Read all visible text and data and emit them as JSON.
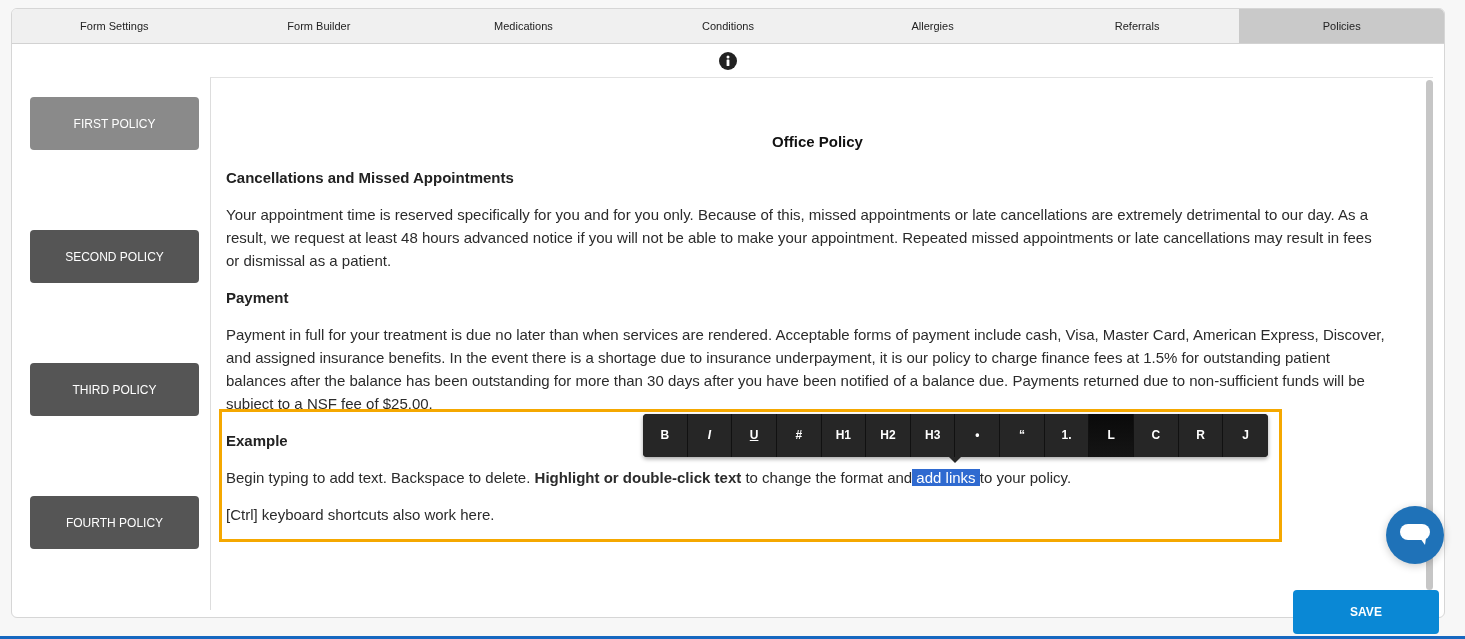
{
  "tabs": [
    {
      "label": "Form Settings",
      "selected": false
    },
    {
      "label": "Form Builder",
      "selected": false
    },
    {
      "label": "Medications",
      "selected": false
    },
    {
      "label": "Conditions",
      "selected": false
    },
    {
      "label": "Allergies",
      "selected": false
    },
    {
      "label": "Referrals",
      "selected": false
    },
    {
      "label": "Policies",
      "selected": true
    }
  ],
  "policies": [
    {
      "label": "FIRST POLICY",
      "selected": true
    },
    {
      "label": "SECOND POLICY",
      "selected": false
    },
    {
      "label": "THIRD POLICY",
      "selected": false
    },
    {
      "label": "FOURTH POLICY",
      "selected": false
    }
  ],
  "editor": {
    "title": "Office Policy",
    "sections": [
      {
        "heading": "Cancellations and Missed Appointments",
        "focused": false,
        "paragraphs": [
          [
            {
              "text": "Your appointment time is reserved specifically for you and for you only. Because of this, missed appointments or late cancellations are extremely detrimental to our day. As a result, we request at least 48 hours advanced notice if you will not be able to make your appointment. Repeated missed appointments or late cancellations may result in fees or dismissal as a patient.",
              "highlighted": false
            }
          ]
        ]
      },
      {
        "heading": "Payment",
        "focused": false,
        "paragraphs": [
          [
            {
              "text": "Payment in full for your treatment is due no later than when services are rendered. Acceptable forms of payment include cash, Visa, Master Card, American Express, Discover, and assigned insurance benefits. In the event there is a shortage due to insurance underpayment, it is our policy to charge finance fees at 1.5% for outstanding patient balances after the balance has been outstanding for more than 30 days after you have been notified of a balance due. Payments returned due to non-sufficient funds will be subject to a NSF fee of $25.00.",
              "highlighted": false
            }
          ]
        ]
      },
      {
        "heading": "Example",
        "focused": true,
        "paragraphs": [
          [
            {
              "text": "Begin typing to add text. Backspace to delete. **Highlight or double-click text** to change the format and",
              "highlighted": false
            },
            {
              "text": " add links ",
              "highlighted": true
            },
            {
              "text": "to your policy.",
              "highlighted": false
            }
          ],
          [
            {
              "text": "[Ctrl] keyboard shortcuts also work here.",
              "highlighted": false
            }
          ]
        ],
        "toolbar": [
          {
            "label": "B",
            "kind": "bold",
            "selected": false
          },
          {
            "label": "I",
            "kind": "italic",
            "selected": false
          },
          {
            "label": "U",
            "kind": "underline",
            "selected": false
          },
          {
            "label": "#",
            "kind": "plain",
            "selected": false
          },
          {
            "label": "H1",
            "kind": "plain",
            "selected": false
          },
          {
            "label": "H2",
            "kind": "plain",
            "selected": false
          },
          {
            "label": "H3",
            "kind": "plain",
            "selected": false
          },
          {
            "label": "•",
            "kind": "plain",
            "selected": false
          },
          {
            "label": "“",
            "kind": "plain",
            "selected": false
          },
          {
            "label": "1.",
            "kind": "plain",
            "selected": false
          },
          {
            "label": "L",
            "kind": "plain",
            "selected": true
          },
          {
            "label": "C",
            "kind": "plain",
            "selected": false
          },
          {
            "label": "R",
            "kind": "plain",
            "selected": false
          },
          {
            "label": "J",
            "kind": "plain",
            "selected": false
          }
        ]
      }
    ]
  },
  "save_button": {
    "label": "SAVE"
  }
}
